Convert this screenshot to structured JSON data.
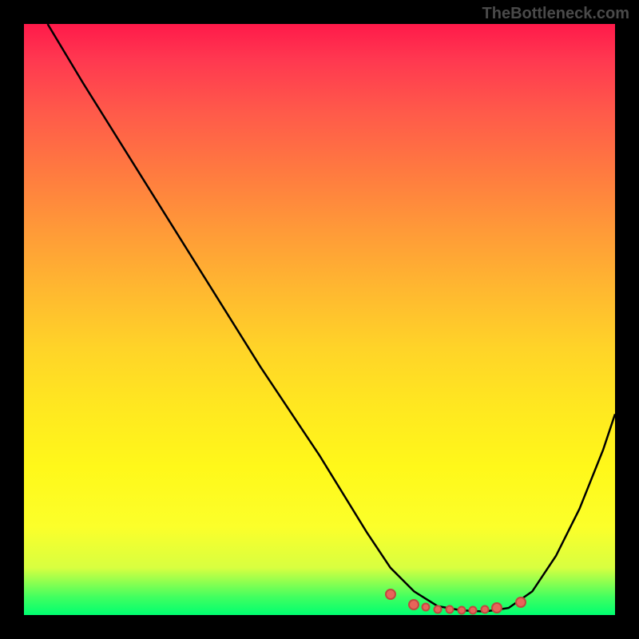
{
  "watermark": "TheBottleneck.com",
  "chart_data": {
    "type": "line",
    "title": "",
    "xlabel": "",
    "ylabel": "",
    "xlim": [
      0,
      100
    ],
    "ylim": [
      0,
      100
    ],
    "series": [
      {
        "name": "curve",
        "x": [
          4,
          10,
          20,
          30,
          40,
          50,
          58,
          62,
          66,
          70,
          74,
          78,
          82,
          86,
          90,
          94,
          98,
          100
        ],
        "values": [
          100,
          90,
          74,
          58,
          42,
          27,
          14,
          8,
          4,
          1.5,
          0.8,
          0.6,
          1.2,
          4,
          10,
          18,
          28,
          34
        ]
      }
    ],
    "markers": {
      "x": [
        62,
        66,
        68,
        70,
        72,
        74,
        76,
        78,
        80,
        84
      ],
      "values": [
        3.5,
        1.8,
        1.3,
        1.0,
        0.9,
        0.8,
        0.8,
        0.9,
        1.2,
        2.2
      ]
    },
    "colors": {
      "curve": "#000000",
      "marker_fill": "#e8645a",
      "marker_stroke": "#c04840",
      "gradient_top": "#ff1a4a",
      "gradient_bottom": "#00ff70"
    }
  }
}
